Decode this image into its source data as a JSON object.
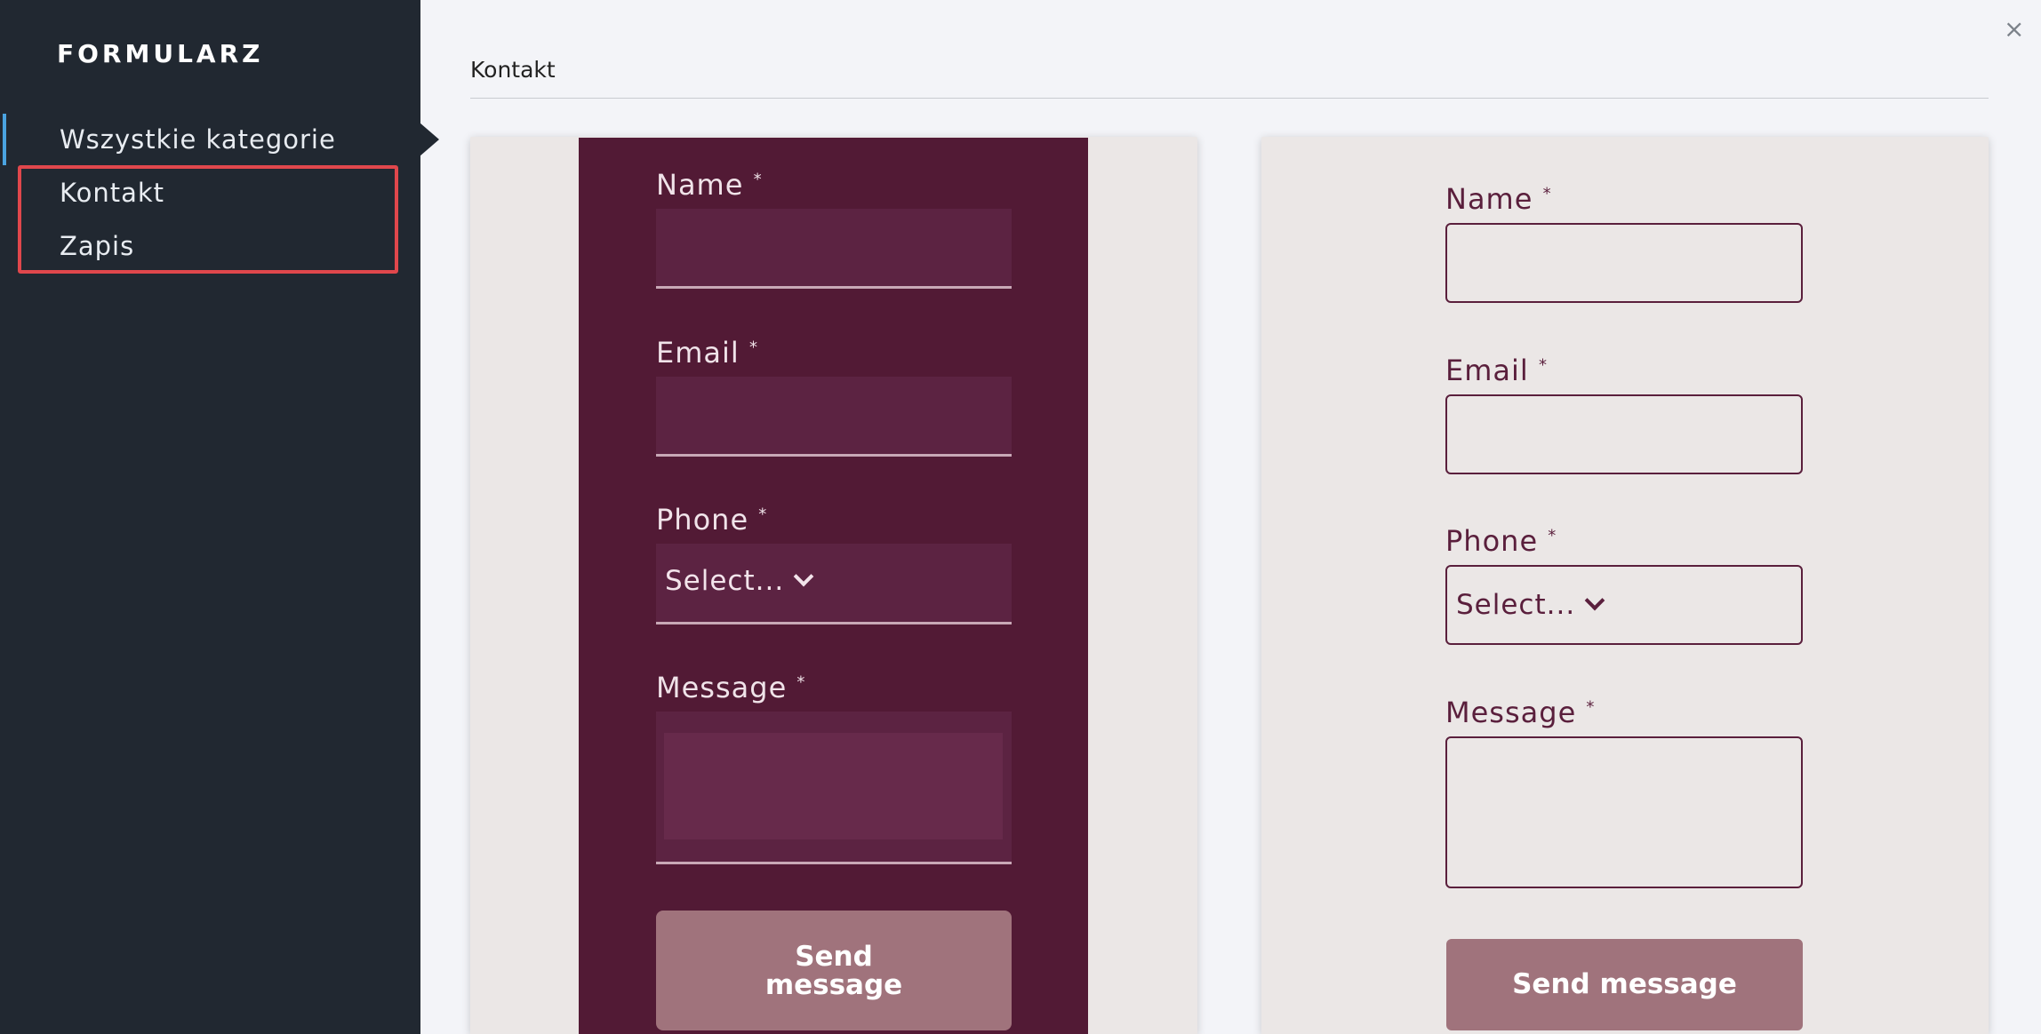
{
  "sidebar": {
    "brand": "FORMULARZ",
    "items": [
      {
        "label": "Wszystkie kategorie",
        "active": true
      },
      {
        "label": "Kontakt",
        "active": false
      },
      {
        "label": "Zapis",
        "active": false
      }
    ]
  },
  "header": {
    "title": "Kontakt",
    "close_icon": "×"
  },
  "form_left": {
    "name_label": "Name",
    "email_label": "Email",
    "phone_label": "Phone",
    "phone_select": "Select...",
    "message_label": "Message",
    "required_mark": "*",
    "button_line1": "Send",
    "button_line2": "message"
  },
  "form_right": {
    "name_label": "Name",
    "email_label": "Email",
    "phone_label": "Phone",
    "phone_select": "Select...",
    "message_label": "Message",
    "required_mark": "*",
    "button_label": "Send message"
  },
  "colors": {
    "sidebar_bg": "#212831",
    "maroon": "#521a35",
    "button": "#a0737c",
    "highlight": "#e0474c",
    "accent": "#4aa3e0"
  }
}
